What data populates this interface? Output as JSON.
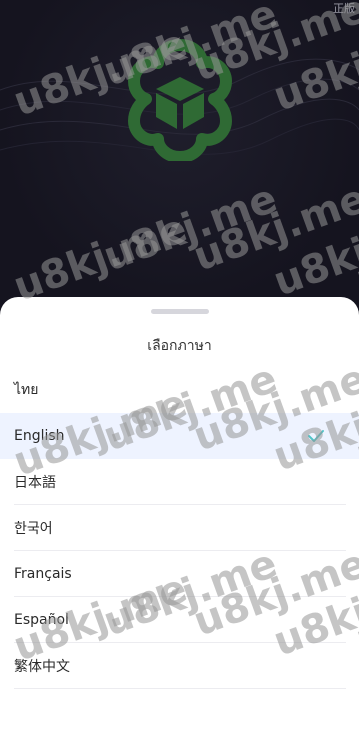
{
  "corner_label": "正版",
  "sheet": {
    "title": "เลือกภาษา",
    "languages": [
      {
        "label": "ไทย",
        "selected": false
      },
      {
        "label": "English",
        "selected": true
      },
      {
        "label": "日本語",
        "selected": false
      },
      {
        "label": "한국어",
        "selected": false
      },
      {
        "label": "Français",
        "selected": false
      },
      {
        "label": "Español",
        "selected": false
      },
      {
        "label": "繁体中文",
        "selected": false
      }
    ]
  },
  "watermark": "u8kj.me",
  "colors": {
    "hero_background": "#15141f",
    "logo_green": "#2f6a34",
    "selected_row": "#eef3ff",
    "check": "#4fc3c7"
  },
  "icons": {
    "logo": "hexagon-cube-logo",
    "check": "check-icon"
  }
}
